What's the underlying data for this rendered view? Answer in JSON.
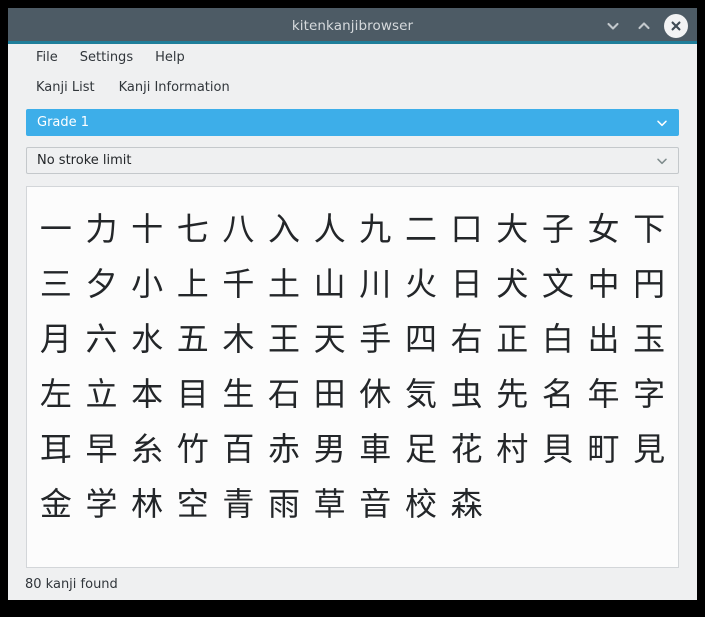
{
  "window": {
    "title": "kitenkanjibrowser",
    "controls": [
      {
        "name": "minimize-button",
        "icon": "chevron-down-icon"
      },
      {
        "name": "maximize-button",
        "icon": "chevron-up-icon"
      },
      {
        "name": "close-button",
        "icon": "close-icon"
      }
    ]
  },
  "menubar": {
    "items": [
      {
        "label": "File"
      },
      {
        "label": "Settings"
      },
      {
        "label": "Help"
      }
    ]
  },
  "tabs": {
    "items": [
      {
        "label": "Kanji List",
        "selected": true
      },
      {
        "label": "Kanji Information",
        "selected": false
      }
    ]
  },
  "filters": {
    "grade": {
      "label": "Grade 1",
      "icon": "chevron-down-icon",
      "selected": true,
      "accent_color": "#3daee9"
    },
    "stroke": {
      "label": "No stroke limit",
      "icon": "chevron-down-icon",
      "selected": false
    }
  },
  "kanji_list": {
    "columns": 14,
    "characters": [
      "一",
      "力",
      "十",
      "七",
      "八",
      "入",
      "人",
      "九",
      "二",
      "口",
      "大",
      "子",
      "女",
      "下",
      "三",
      "夕",
      "小",
      "上",
      "千",
      "土",
      "山",
      "川",
      "火",
      "日",
      "犬",
      "文",
      "中",
      "円",
      "月",
      "六",
      "水",
      "五",
      "木",
      "王",
      "天",
      "手",
      "四",
      "右",
      "正",
      "白",
      "出",
      "玉",
      "左",
      "立",
      "本",
      "目",
      "生",
      "石",
      "田",
      "休",
      "気",
      "虫",
      "先",
      "名",
      "年",
      "字",
      "耳",
      "早",
      "糸",
      "竹",
      "百",
      "赤",
      "男",
      "車",
      "足",
      "花",
      "村",
      "貝",
      "町",
      "見",
      "金",
      "学",
      "林",
      "空",
      "青",
      "雨",
      "草",
      "音",
      "校",
      "森"
    ]
  },
  "statusbar": {
    "text": "80 kanji found"
  },
  "colors": {
    "titlebar": "#4d5b65",
    "titlebar_accent": "#1f7e9a",
    "window_bg": "#eff0f1",
    "panel_bg": "#fcfcfc",
    "highlight": "#3daee9",
    "text": "#31363b"
  }
}
